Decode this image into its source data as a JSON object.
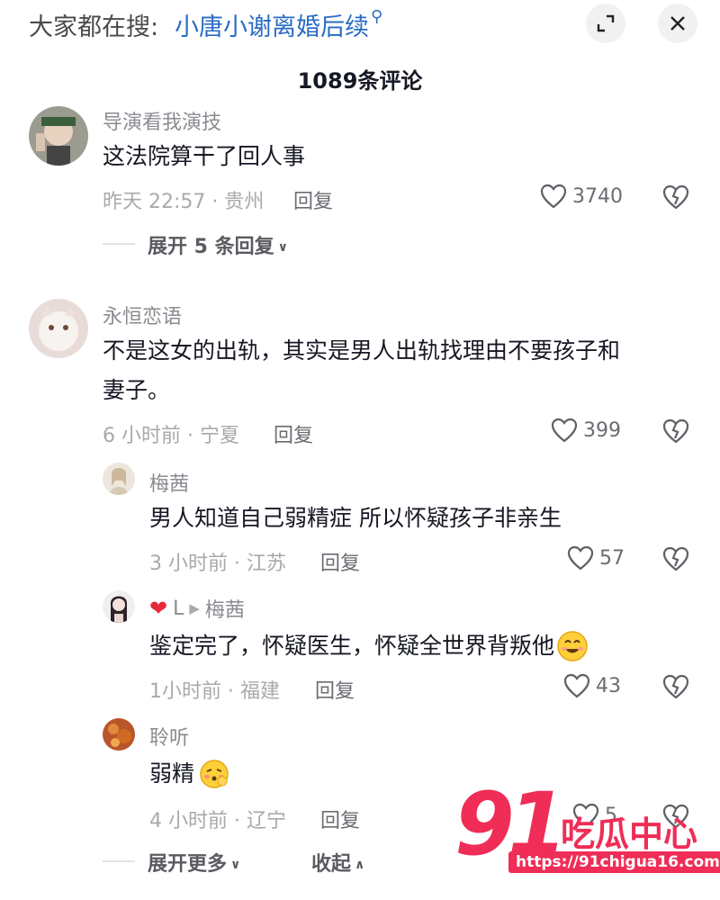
{
  "header": {
    "search_prefix": "大家都在搜:",
    "search_term": "小唐小谢离婚后续",
    "comment_count": "1089条评论"
  },
  "comments": [
    {
      "username": "导演看我演技",
      "text": "这法院算干了回人事",
      "time_location": "昨天 22:57 · 贵州",
      "reply_label": "回复",
      "likes": "3740",
      "expand_label": "展开 5 条回复"
    },
    {
      "username": "永恒恋语",
      "text_line1": "不是这女的出轨，其实是男人出轨找理由不要孩子和",
      "text_line2": "妻子。",
      "time_location": "6 小时前 · 宁夏",
      "reply_label": "回复",
      "likes": "399",
      "replies": [
        {
          "username": "梅茜",
          "text": "男人知道自己弱精症 所以怀疑孩子非亲生",
          "time_location": "3 小时前 · 江苏",
          "reply_label": "回复",
          "likes": "57"
        },
        {
          "username": "L",
          "reply_to": "梅茜",
          "text": "鉴定完了，怀疑医生，怀疑全世界背叛他",
          "time_location": "1小时前 · 福建",
          "reply_label": "回复",
          "likes": "43"
        },
        {
          "username": "聆听",
          "text": "弱精",
          "time_location": "4 小时前 · 辽宁",
          "reply_label": "回复",
          "likes": "5"
        }
      ],
      "expand_more_label": "展开更多",
      "collapse_label": "收起"
    }
  ],
  "watermark": {
    "number": "91",
    "title": "吃瓜中心",
    "url": "https://91chigua16.com"
  },
  "colors": {
    "link_blue": "#2b6cc4",
    "brand_red": "#ef2d56",
    "meta_gray": "#a8a9ad"
  }
}
